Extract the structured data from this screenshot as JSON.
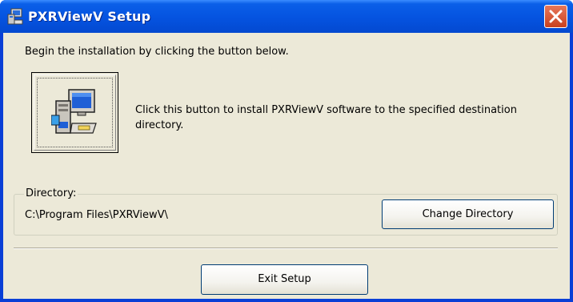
{
  "window": {
    "title": "PXRViewV Setup",
    "app_icon": "setup-computer-icon",
    "close_icon": "close-icon"
  },
  "instructions": "Begin the installation by clicking the button below.",
  "install": {
    "icon": "install-computer-icon",
    "description": "Click this button to install PXRViewV software to the specified destination directory."
  },
  "directory": {
    "label": "Directory:",
    "path": "C:\\Program Files\\PXRViewV\\",
    "change_label": "Change Directory"
  },
  "exit_label": "Exit Setup",
  "colors": {
    "titlebar": "#0553e0",
    "face": "#ece9d8",
    "close": "#c8411f"
  }
}
